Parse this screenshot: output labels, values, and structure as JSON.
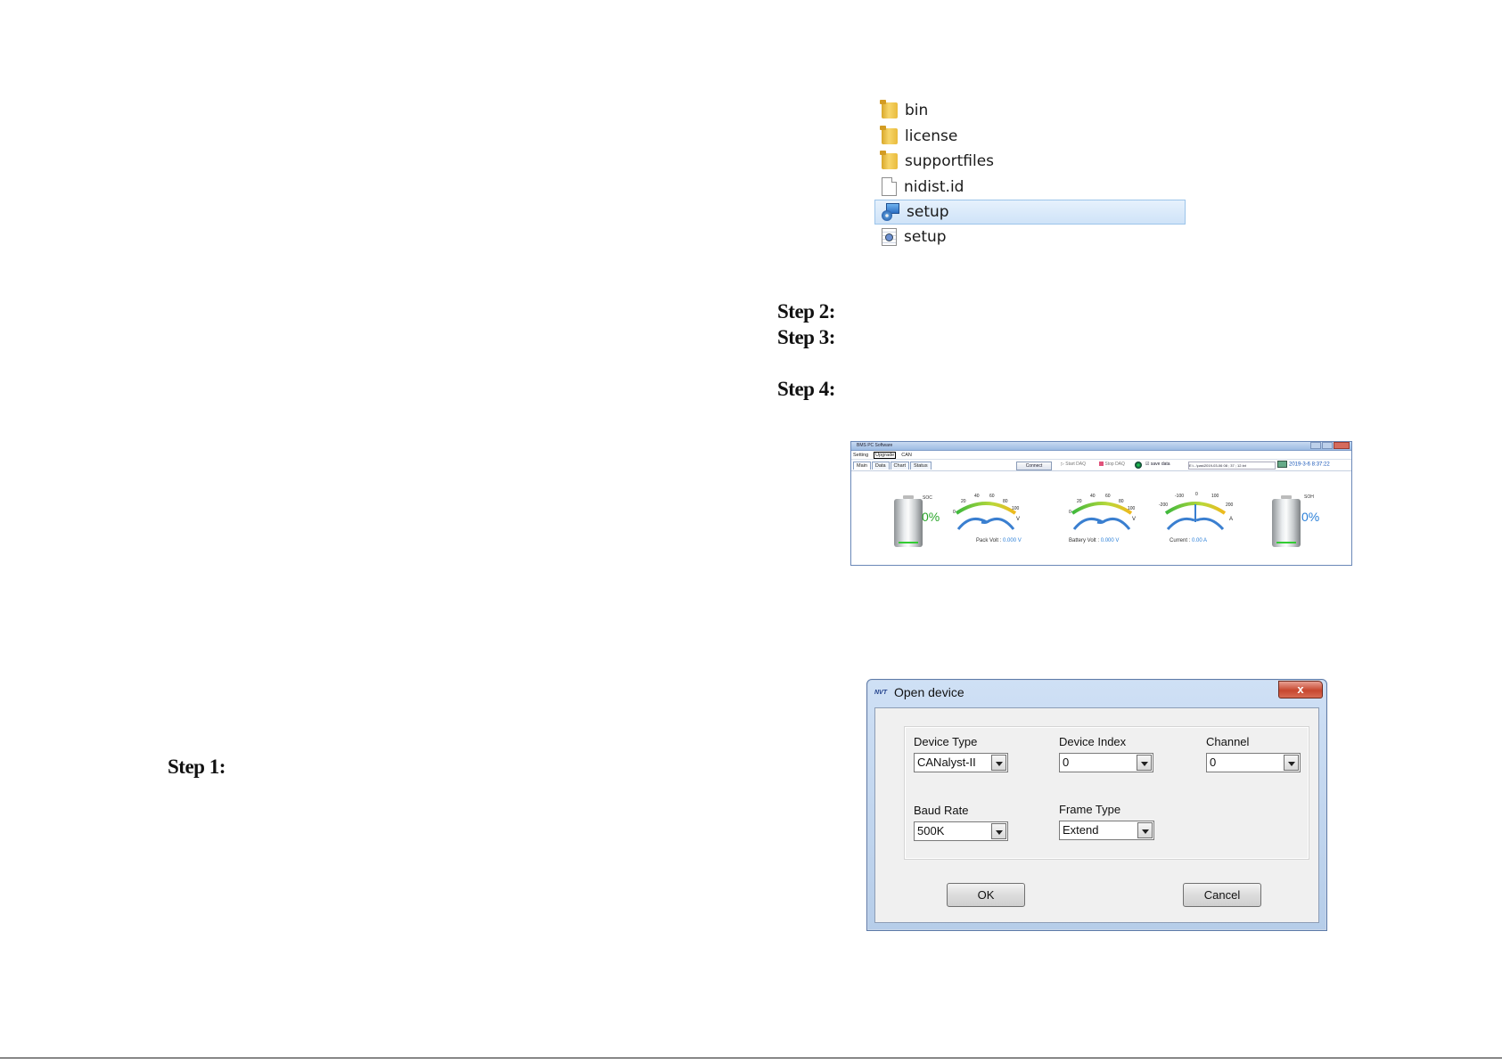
{
  "steps": {
    "step1": "Step 1:",
    "step2": "Step 2:",
    "step3": "Step 3:",
    "step4": "Step 4:"
  },
  "file_list": [
    {
      "name": "bin",
      "icon": "folder-icon"
    },
    {
      "name": "license",
      "icon": "folder-icon"
    },
    {
      "name": "supportfiles",
      "icon": "folder-icon"
    },
    {
      "name": "nidist.id",
      "icon": "document-icon"
    },
    {
      "name": "setup",
      "icon": "setup-exe-icon",
      "selected": true
    },
    {
      "name": "setup",
      "icon": "config-file-icon"
    }
  ],
  "bms": {
    "title": "BMS PC Software",
    "menu": [
      "Setting",
      "Upgrade",
      "CAN"
    ],
    "tabs": [
      "Main",
      "Data",
      "Chart",
      "Status"
    ],
    "connect": "Connect",
    "start_daq": "Start DAQ",
    "stop_daq": "Stop DAQ",
    "save_data": "save data",
    "path": "E:\\...\\pas\\2019-03-06 08 ; 37 ; 12.txt",
    "datetime": "2019-3-6 8:37:22",
    "soc_label": "SOC",
    "soc_value": "0%",
    "soh_label": "SOH",
    "soh_value": "0%",
    "gauges": [
      {
        "caption": "Pack Volt : ",
        "value": "0.000 V",
        "ticks": [
          "0",
          "20",
          "40",
          "60",
          "80",
          "100"
        ],
        "unit": "V"
      },
      {
        "caption": "Battery Volt : ",
        "value": "0.000 V",
        "ticks": [
          "0",
          "20",
          "40",
          "60",
          "80",
          "100"
        ],
        "unit": "V"
      },
      {
        "caption": "Current : ",
        "value": "0.00 A",
        "ticks": [
          "-200",
          "-100",
          "0",
          "100",
          "200"
        ],
        "unit": "A"
      }
    ],
    "colors": {
      "soc": "#2aa52a",
      "soh": "#2a7fd8"
    }
  },
  "dialog": {
    "logo": "NVT",
    "title": "Open device",
    "close": "x",
    "device_type_label": "Device Type",
    "device_type_value": "CANalyst-II",
    "device_index_label": "Device Index",
    "device_index_value": "0",
    "channel_label": "Channel",
    "channel_value": "0",
    "baud_rate_label": "Baud Rate",
    "baud_rate_value": "500K",
    "frame_type_label": "Frame Type",
    "frame_type_value": "Extend",
    "ok": "OK",
    "cancel": "Cancel"
  }
}
